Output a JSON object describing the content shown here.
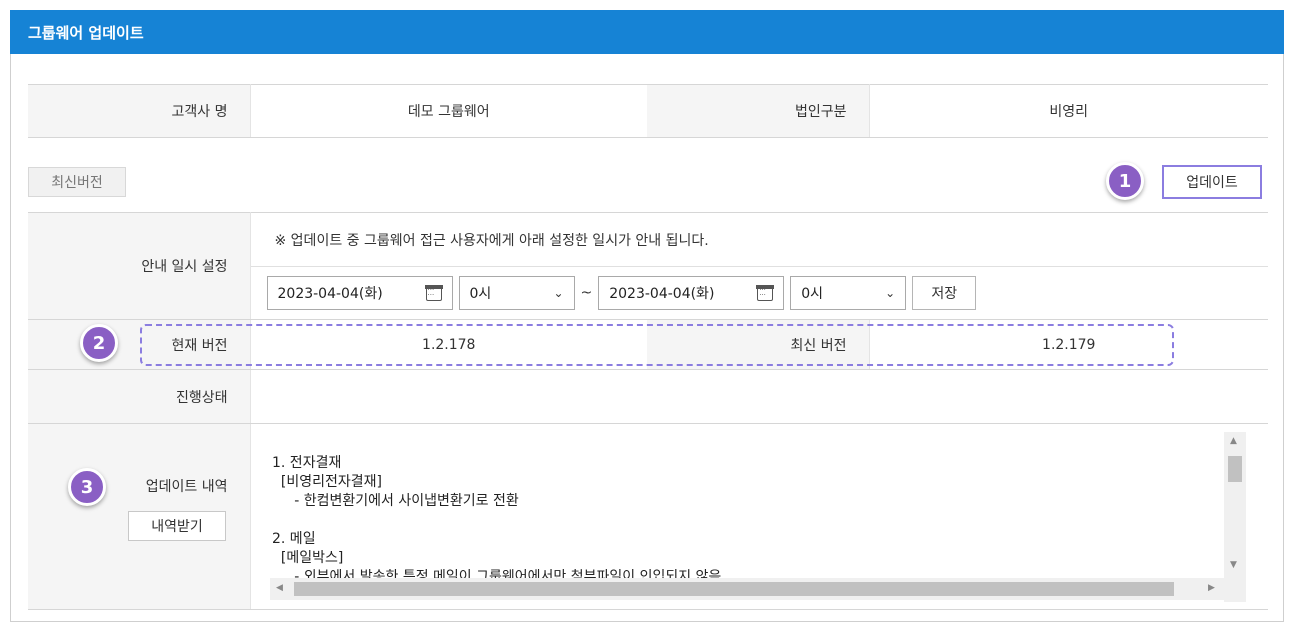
{
  "title": "그룹웨어 업데이트",
  "info": {
    "customer_label": "고객사 명",
    "customer_value": "데모 그룹웨어",
    "corp_label": "법인구분",
    "corp_value": "비영리"
  },
  "buttons": {
    "latest_version": "최신버전",
    "update": "업데이트",
    "save": "저장",
    "download_history": "내역받기"
  },
  "schedule": {
    "label": "안내 일시 설정",
    "notice": "※ 업데이트 중 그룹웨어 접근 사용자에게 아래 설정한 일시가 안내 됩니다.",
    "start_date": "2023-04-04(화)",
    "start_hour": "0시",
    "range_sep": "~",
    "end_date": "2023-04-04(화)",
    "end_hour": "0시"
  },
  "version": {
    "current_label": "현재 버전",
    "current_value": "1.2.178",
    "latest_label": "최신 버전",
    "latest_value": "1.2.179"
  },
  "progress": {
    "label": "진행상태",
    "value": ""
  },
  "history": {
    "label": "업데이트 내역",
    "content": "1. 전자결재\n  [비영리전자결재]\n     - 한컴변환기에서 사이냅변환기로 전환\n\n2. 메일\n  [메일박스]\n     - 외부에서 발송한 특정 메일이 그룹웨어에서만 첨부파일이 인입되지 않음"
  },
  "badges": [
    "1",
    "2",
    "3"
  ],
  "colors": {
    "header": "#1683d5",
    "accent": "#8b7de0",
    "badge": "#8a5fc4"
  }
}
